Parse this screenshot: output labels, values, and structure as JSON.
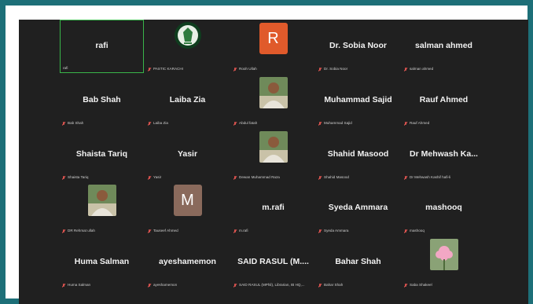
{
  "colors": {
    "active_border": "#39b54a",
    "mic_muted": "#d9534f",
    "avatar_r": "#e05a2b",
    "avatar_m": "#8a6a5c"
  },
  "rows": [
    [
      {
        "name": "rafi",
        "caption": "rafi",
        "active": true,
        "mic": false
      },
      {
        "name": "",
        "caption": "PASTIC KARACHI",
        "visual": "logo",
        "mic": true
      },
      {
        "name": "",
        "caption": "Rooh Ullah",
        "visual": "letter",
        "letter": "R",
        "mic": true
      },
      {
        "name": "Dr. Sobia Noor",
        "caption": "Dr. Sobia Noor",
        "mic": true
      },
      {
        "name": "salman ahmed",
        "caption": "salman ahmed",
        "mic": true
      }
    ],
    [
      {
        "name": "Bab Shah",
        "caption": "Bab Shah",
        "mic": true
      },
      {
        "name": "Laiba Zia",
        "caption": "Laiba Zia",
        "mic": true
      },
      {
        "name": "",
        "caption": "Abdul fatah",
        "visual": "photo",
        "mic": true
      },
      {
        "name": "Muhammad Sajid",
        "caption": "Muhammad Sajid",
        "mic": true
      },
      {
        "name": "Rauf Ahmed",
        "caption": "Rauf Ahmed",
        "mic": true
      }
    ],
    [
      {
        "name": "Shaista Tariq",
        "caption": "Shaista Tariq",
        "mic": true
      },
      {
        "name": "Yasir",
        "caption": "Yasir",
        "mic": true
      },
      {
        "name": "",
        "caption": "Dewan Muhammad Raza",
        "visual": "photo",
        "mic": true
      },
      {
        "name": "Shahid Masood",
        "caption": "Shahid Masood",
        "mic": true
      },
      {
        "name": "Dr Mehwash Ka...",
        "caption": "Dr Mehwash Kashif hafi-li",
        "mic": true
      }
    ],
    [
      {
        "name": "",
        "caption": "DR Rehmat ullah",
        "visual": "photo",
        "mic": true
      },
      {
        "name": "",
        "caption": "Tauseef Ahmed",
        "visual": "letter",
        "letter": "M",
        "mic": true
      },
      {
        "name": "m.rafi",
        "caption": "m.rafi",
        "mic": true
      },
      {
        "name": "Syeda Ammara",
        "caption": "Syeda Ammara",
        "mic": true
      },
      {
        "name": "mashooq",
        "caption": "mashooq",
        "mic": true
      }
    ],
    [
      {
        "name": "Huma Salman",
        "caption": "Huma Salman",
        "mic": true
      },
      {
        "name": "ayeshamemon",
        "caption": "ayeshamemon",
        "mic": true
      },
      {
        "name": "SAID RASUL (M....",
        "caption": "SAID RASUL (MPhil), Librarian, IB HQ,...",
        "mic": true
      },
      {
        "name": "Bahar Shah",
        "caption": "Bahar Shah",
        "mic": true
      },
      {
        "name": "",
        "caption": "Saba Shakeel",
        "visual": "flower",
        "mic": true
      }
    ]
  ]
}
